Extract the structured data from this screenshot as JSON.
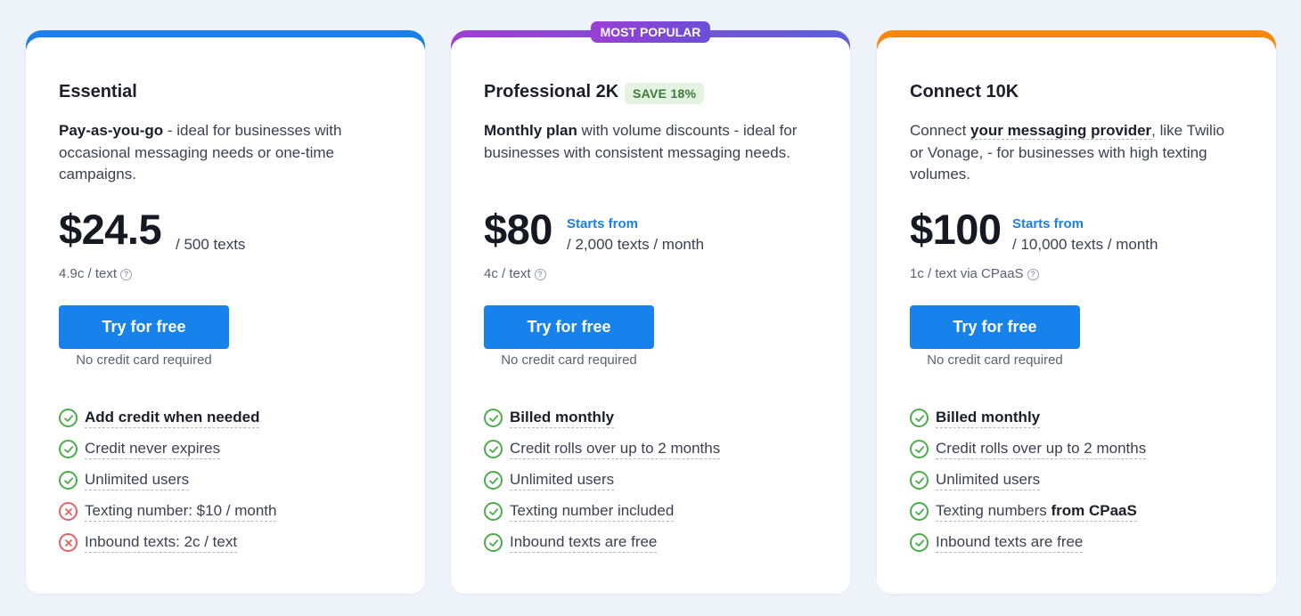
{
  "plans": [
    {
      "name": "Essential",
      "badge": "",
      "top_badge": "",
      "accent": "#1a7fe6",
      "desc_bold": "Pay-as-you-go",
      "desc_rest": " - ideal for businesses with occasional messaging needs or one-time campaigns.",
      "price": "$24.5",
      "starts_from": "",
      "per": "/ 500 texts",
      "unit": "4.9c / text",
      "cta": "Try for free",
      "cta_note": "No credit card required",
      "features": [
        {
          "text": "Add credit when needed",
          "bold": true,
          "included": true
        },
        {
          "text": "Credit never expires",
          "bold": false,
          "included": true
        },
        {
          "text": "Unlimited users",
          "bold": false,
          "included": true
        },
        {
          "text": "Texting number: $10 / month",
          "bold": false,
          "included": false
        },
        {
          "text": "Inbound texts: 2c / text",
          "bold": false,
          "included": false
        }
      ]
    },
    {
      "name": "Professional 2K",
      "badge": "SAVE 18%",
      "top_badge": "MOST POPULAR",
      "accent": "#8a44d8",
      "desc_bold": "Monthly plan",
      "desc_rest": " with volume discounts - ideal for businesses with consistent messaging needs.",
      "price": "$80",
      "starts_from": "Starts from",
      "per": "/ 2,000 texts / month",
      "unit": "4c / text",
      "cta": "Try for free",
      "cta_note": "No credit card required",
      "features": [
        {
          "text": "Billed monthly",
          "bold": true,
          "included": true
        },
        {
          "text": "Credit rolls over up to 2 months",
          "bold": false,
          "included": true
        },
        {
          "text": "Unlimited users",
          "bold": false,
          "included": true
        },
        {
          "text": "Texting number included",
          "bold": false,
          "included": true
        },
        {
          "text": "Inbound texts are free",
          "bold": false,
          "included": true
        }
      ]
    },
    {
      "name": "Connect 10K",
      "badge": "",
      "top_badge": "",
      "accent": "#f5870f",
      "desc_pre": "Connect ",
      "desc_link": "your messaging provider",
      "desc_rest": ", like Twilio or Vonage, - for businesses with high texting volumes.",
      "price": "$100",
      "starts_from": "Starts from",
      "per": "/ 10,000 texts / month",
      "unit": "1c / text via CPaaS",
      "cta": "Try for free",
      "cta_note": "No credit card required",
      "features": [
        {
          "text": "Billed monthly",
          "bold": true,
          "included": true
        },
        {
          "text": "Credit rolls over up to 2 months",
          "bold": false,
          "included": true
        },
        {
          "text": "Unlimited users",
          "bold": false,
          "included": true
        },
        {
          "text": "Texting numbers ",
          "bold_suffix": "from CPaaS",
          "bold": false,
          "included": true
        },
        {
          "text": "Inbound texts are free",
          "bold": false,
          "included": true
        }
      ]
    }
  ],
  "icons": {
    "help": "question-circle-icon",
    "included": "check-circle-icon",
    "excluded": "x-circle-icon"
  },
  "help_glyph": "?"
}
